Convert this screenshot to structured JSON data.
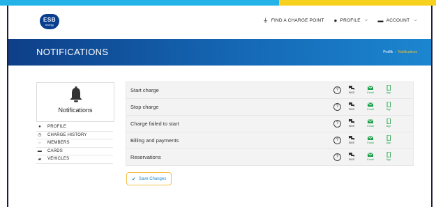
{
  "header": {
    "logo_text": "ESB",
    "logo_sub": "energy",
    "nav": [
      {
        "label": "FIND A CHARGE POINT",
        "icon": "plug-icon"
      },
      {
        "label": "PROFILE",
        "icon": "user-icon"
      },
      {
        "label": "ACCOUNT",
        "icon": "car-icon"
      }
    ]
  },
  "banner": {
    "title": "NOTIFICATIONS",
    "breadcrumb": [
      "Profilk",
      "Notifications"
    ]
  },
  "side": {
    "card_label": "Notifications",
    "menu": [
      {
        "label": "PROFILE",
        "icon": "user-icon"
      },
      {
        "label": "CHARGE HISTORY",
        "icon": "clock-icon"
      },
      {
        "label": "MEMBERS",
        "icon": "group-icon"
      },
      {
        "label": "CARDS",
        "icon": "card-icon"
      },
      {
        "label": "VEHICLES",
        "icon": "car-icon"
      }
    ]
  },
  "notifications": {
    "rows": [
      {
        "label": "Start charge"
      },
      {
        "label": "Stop charge"
      },
      {
        "label": "Charge failed to start"
      },
      {
        "label": "Billing and payments"
      },
      {
        "label": "Reservations"
      }
    ],
    "channels": {
      "sms": "SMS",
      "email": "Email",
      "app": "App"
    },
    "help_glyph": "?"
  },
  "actions": {
    "save_label": "Save Changes"
  },
  "colors": {
    "accent_blue": "#1d88d4",
    "green": "#1fa04a",
    "banner": "#1568b5",
    "stripe_blue": "#24b3e8",
    "stripe_yellow": "#f7d11e"
  }
}
